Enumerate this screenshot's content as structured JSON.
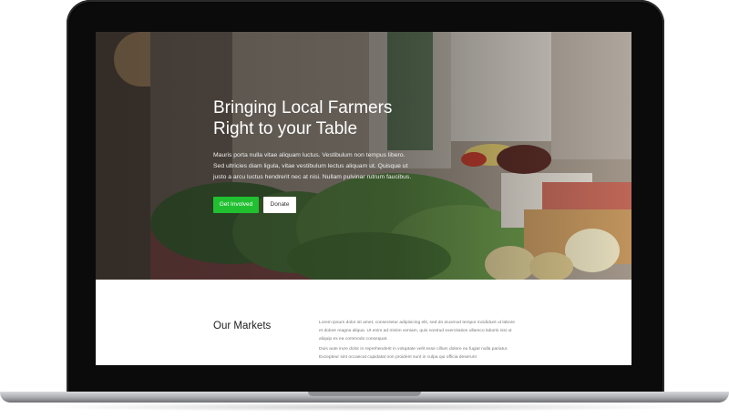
{
  "hero": {
    "title_line1": "Bringing Local Farmers",
    "title_line2": "Right to your Table",
    "text": "Mauris porta nulla vitae aliquam luctus. Vestibulum non tempus libero. Sed ultricies diam ligula, vitae vestibulum lectus aliquam ut. Quisque ut justo a arcu luctus hendrerit nec at nisi. Nullam pulvinar rutrum faucibus.",
    "primary_button": "Get Involved",
    "secondary_button": "Donate"
  },
  "markets": {
    "title": "Our Markets",
    "paragraph1": "Lorem ipsum dolor sit amet, consectetur adipisicing elit, sed do eiusmod tempor incididunt ut labore et dolore magna aliqua. Ut enim ad minim veniam, quis nostrud exercitation ullamco laboris nisi ut aliquip ex ea commodo consequat.",
    "paragraph2": "Duis aute irure dolor in reprehenderit in voluptate velit esse cillum dolore eu fugiat nulla pariatur. Excepteur sint occaecat cupidatat non proident sunt in culpa qui officia deserunt"
  },
  "colors": {
    "accent_green": "#20c030",
    "laptop_bezel": "#0b0b0b"
  }
}
